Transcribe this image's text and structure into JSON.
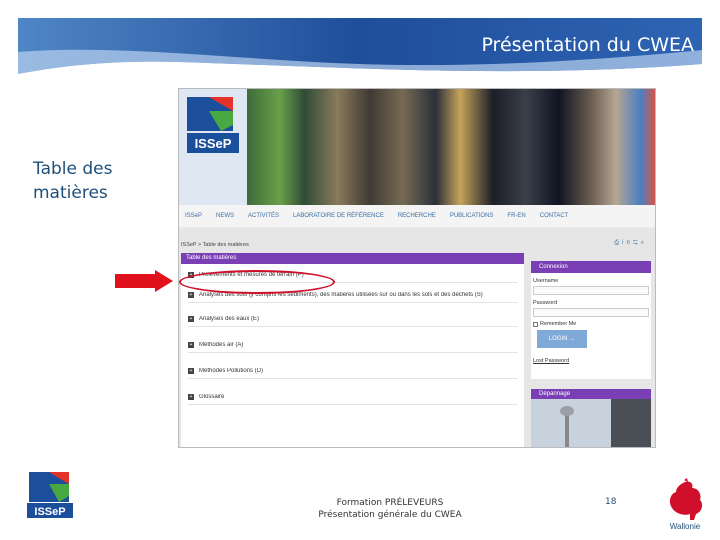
{
  "slide": {
    "title": "Présentation du CWEA",
    "section_title": "Table des matières",
    "footer_line1": "Formation PRÉLEVEURS",
    "footer_line2": "Présentation générale du CWEA",
    "page_number": "18",
    "region_label": "Wallonie"
  },
  "colors": {
    "banner_blue": "#1f4e79",
    "site_purple": "#7b3fb5",
    "highlight_red": "#d0102a",
    "arrow_red": "#e0101c"
  },
  "site": {
    "logo_text": "ISSeP",
    "nav": [
      "ISSeP",
      "NEWS",
      "ACTIVITÉS",
      "LABORATOIRE DE RÉFÉRENCE",
      "RECHERCHE",
      "PUBLICATIONS",
      "FR-EN",
      "CONTACT"
    ],
    "breadcrumb": "ISSeP > Table des matières",
    "toolbar_icons": [
      "print-icon",
      "linkedin-icon",
      "share-icon",
      "search-icon"
    ],
    "toc_header": "Table des matières",
    "toc_items": [
      "Prélèvements et mesures de terrain (P)",
      "Analyses des sols (y compris les sédiments), des matières utilisées sur ou dans les sols et des déchets (S)",
      "Analyses des eaux (E)",
      "Méthodes air (A)",
      "Méthodes Pollutions (D)",
      "Glossaire"
    ],
    "login": {
      "header": "Connexion",
      "username_label": "Username",
      "password_label": "Password",
      "remember_label": "Remember Me",
      "button": "LOGIN →",
      "lost_password": "Lost Password"
    },
    "depannage_header": "Dépannage"
  }
}
